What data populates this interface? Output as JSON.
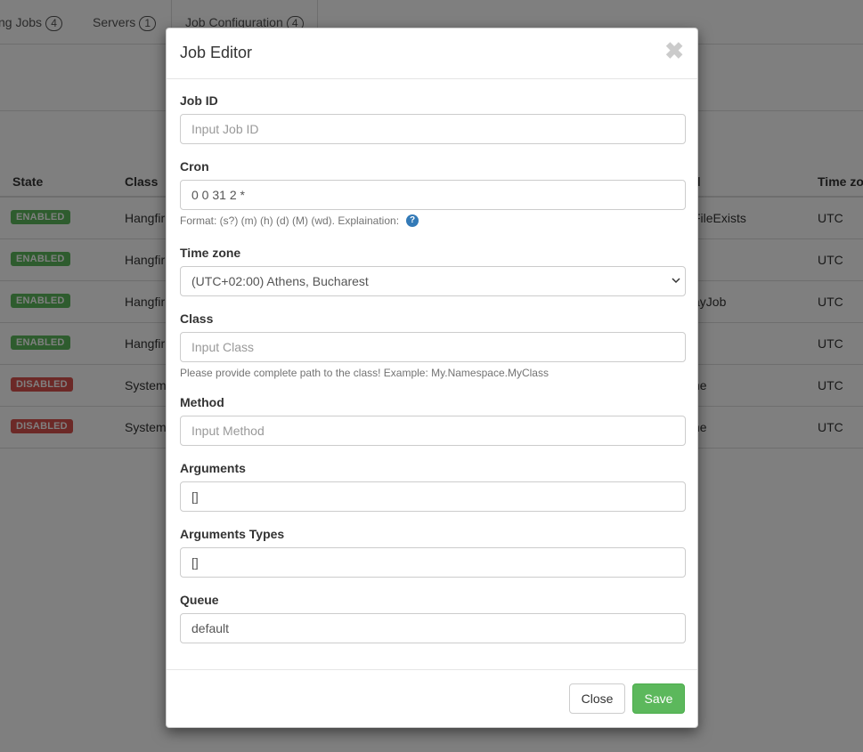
{
  "tabs": [
    {
      "label": "ng Jobs",
      "count": "4"
    },
    {
      "label": "Servers",
      "count": "1"
    },
    {
      "label": "Job Configuration",
      "count": "4"
    }
  ],
  "table": {
    "headers": {
      "state": "State",
      "class": "Class",
      "method": "d",
      "timezone": "Time zo"
    },
    "rows": [
      {
        "state": "ENABLED",
        "class": "Hangfir",
        "method": "FileExists",
        "timezone": "UTC"
      },
      {
        "state": "ENABLED",
        "class": "Hangfir",
        "method": "",
        "timezone": "UTC"
      },
      {
        "state": "ENABLED",
        "class": "Hangfir",
        "method": "ayJob",
        "timezone": "UTC"
      },
      {
        "state": "ENABLED",
        "class": "Hangfir",
        "method": "",
        "timezone": "UTC"
      },
      {
        "state": "DISABLED",
        "class": "System",
        "method": "ne",
        "timezone": "UTC"
      },
      {
        "state": "DISABLED",
        "class": "System",
        "method": "ne",
        "timezone": "UTC"
      }
    ]
  },
  "modal": {
    "title": "Job Editor",
    "close_glyph": "✖",
    "job_id": {
      "label": "Job ID",
      "value": "",
      "placeholder": "Input Job ID"
    },
    "cron": {
      "label": "Cron",
      "value": "0 0 31 2 *",
      "help": "Format: (s?) (m) (h) (d) (M) (wd). Explaination:",
      "help_icon": "?"
    },
    "timezone": {
      "label": "Time zone",
      "selected": "(UTC+02:00) Athens, Bucharest"
    },
    "class": {
      "label": "Class",
      "value": "",
      "placeholder": "Input Class",
      "help": "Please provide complete path to the class! Example: My.Namespace.MyClass"
    },
    "method": {
      "label": "Method",
      "value": "",
      "placeholder": "Input Method"
    },
    "arguments": {
      "label": "Arguments",
      "value": "[]"
    },
    "argument_types": {
      "label": "Arguments Types",
      "value": "[]"
    },
    "queue": {
      "label": "Queue",
      "value": "default"
    },
    "buttons": {
      "close": "Close",
      "save": "Save"
    }
  },
  "colors": {
    "enabled": "#5cb85c",
    "disabled": "#d9534f",
    "save": "#5cb85c",
    "help_icon": "#337ab7"
  }
}
